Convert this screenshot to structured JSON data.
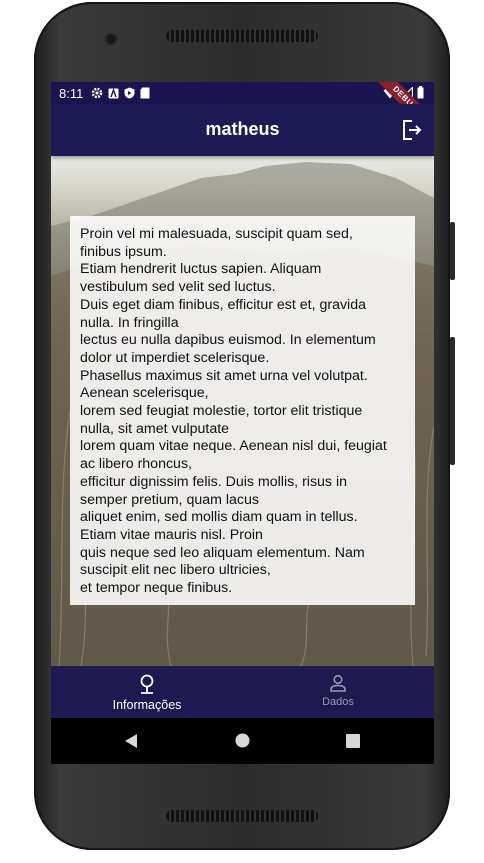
{
  "status_bar": {
    "time": "8:11",
    "left_icons": [
      "gear-icon",
      "a-icon",
      "play-protect-icon",
      "sd-card-icon"
    ],
    "right_icons": [
      "wifi-icon",
      "signal-icon",
      "battery-icon"
    ],
    "debug_banner": "DEBUG"
  },
  "app_bar": {
    "title": "matheus",
    "action_icon": "logout-icon"
  },
  "card": {
    "text": "Proin vel mi malesuada, suscipit quam sed,\nfinibus ipsum.\nEtiam hendrerit luctus sapien. Aliquam\nvestibulum sed velit sed luctus.\nDuis eget diam finibus, efficitur est et, gravida\nnulla. In fringilla\nlectus eu nulla dapibus euismod. In elementum\ndolor ut imperdiet scelerisque.\nPhasellus maximus sit amet urna vel volutpat.\nAenean scelerisque,\nlorem sed feugiat molestie, tortor elit tristique\nnulla, sit amet vulputate\n lorem quam vitae neque. Aenean nisl dui, feugiat\nac libero rhoncus,\nefficitur dignissim felis. Duis mollis, risus in\nsemper pretium, quam lacus\n aliquet enim, sed mollis diam quam in tellus.\nEtiam vitae mauris nisl. Proin\n quis neque sed leo aliquam elementum. Nam\nsuscipit elit nec libero ultricies,\net tempor neque finibus."
  },
  "bottom_nav": {
    "items": [
      {
        "label": "Informações",
        "icon": "location-pin-icon",
        "active": true
      },
      {
        "label": "Dados",
        "icon": "person-icon",
        "active": false
      }
    ]
  },
  "system_nav": {
    "buttons": [
      "back-icon",
      "home-icon",
      "recents-icon"
    ]
  },
  "colors": {
    "app_bar": "#1e1a55",
    "status_bar": "#1b1450",
    "bottom_nav": "#1e1950",
    "debug_banner": "#8a1f2d",
    "active_nav": "#ffffff",
    "inactive_nav": "#9a98b8"
  }
}
